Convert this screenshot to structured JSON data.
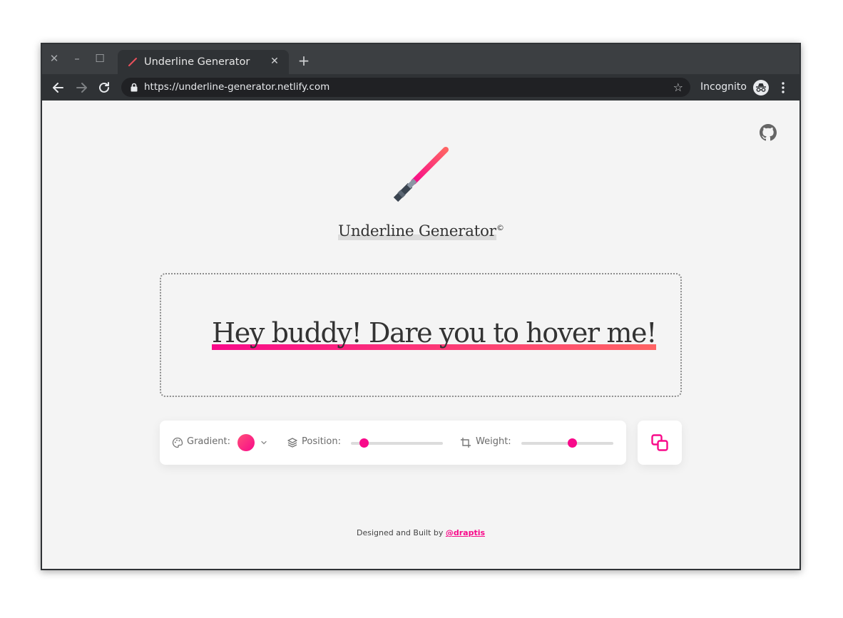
{
  "browser": {
    "tab_title": "Underline Generator",
    "url": "https://underline-generator.netlify.com",
    "incognito_label": "Incognito",
    "icons": {
      "close": "close-icon",
      "minimize": "minimize-icon",
      "maximize": "maximize-icon",
      "tab_close": "close-icon",
      "new_tab": "plus-icon",
      "back": "arrow-left-icon",
      "forward": "arrow-right-icon",
      "reload": "reload-icon",
      "lock": "lock-icon",
      "star": "star-icon",
      "incognito": "incognito-icon",
      "menu": "vertical-dots-icon"
    }
  },
  "app": {
    "title": "Underline Generator",
    "title_mark": "©",
    "preview_text": "Hey buddy! Dare you to hover me!",
    "controls": {
      "gradient_label": "Gradient:",
      "position_label": "Position:",
      "weight_label": "Weight:",
      "position_value": 0.14,
      "weight_value": 0.55
    },
    "footer_text": "Designed and Built by",
    "footer_link": "@draptis",
    "colors": {
      "accent": "#f80a8a",
      "gradient_start": "#f80a8a",
      "gradient_end": "#ff6464"
    }
  }
}
